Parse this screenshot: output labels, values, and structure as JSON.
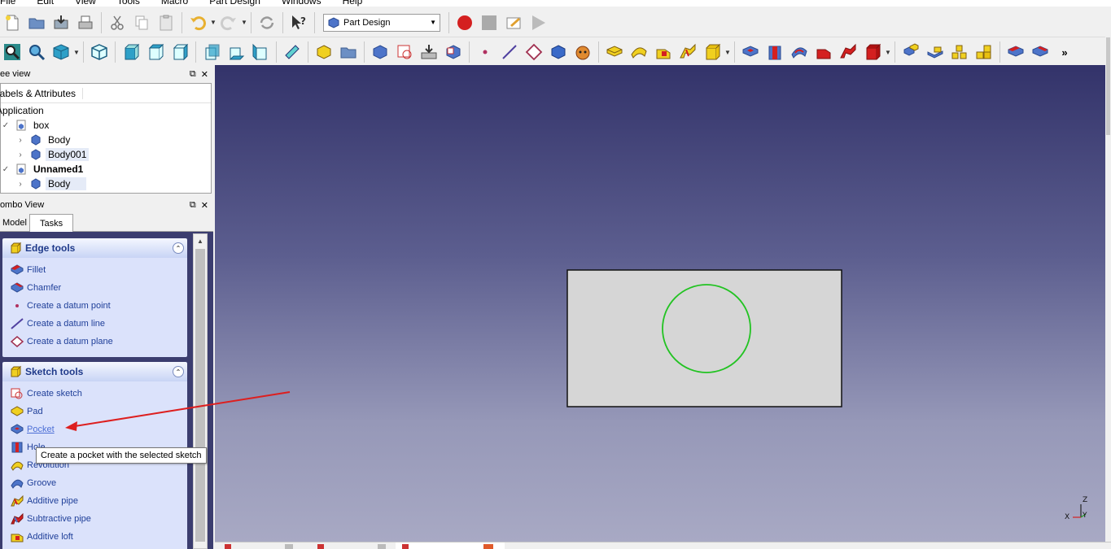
{
  "menu": [
    "File",
    "Edit",
    "View",
    "Tools",
    "Macro",
    "Part Design",
    "Windows",
    "Help"
  ],
  "workbench": {
    "selected": "Part Design"
  },
  "tree_panel": {
    "title": "Tree view",
    "header": "Labels & Attributes",
    "root": "Application",
    "items": [
      {
        "label": "box",
        "level": 1,
        "expanded": true,
        "bold": false
      },
      {
        "label": "Body",
        "level": 2,
        "expanded": false,
        "bold": false
      },
      {
        "label": "Body001",
        "level": 2,
        "expanded": false,
        "bold": false,
        "selected": true
      },
      {
        "label": "Unnamed1",
        "level": 1,
        "expanded": true,
        "bold": true
      },
      {
        "label": "Body",
        "level": 2,
        "expanded": false,
        "bold": false,
        "selected": true
      }
    ]
  },
  "combo": {
    "title": "Combo View",
    "tabs": [
      "Model",
      "Tasks"
    ],
    "active_tab": "Tasks"
  },
  "edge_tools": {
    "title": "Edge tools",
    "items": [
      "Fillet",
      "Chamfer",
      "Create a datum point",
      "Create a datum line",
      "Create a datum plane"
    ]
  },
  "sketch_tools": {
    "title": "Sketch tools",
    "items": [
      "Create sketch",
      "Pad",
      "Pocket",
      "Hole",
      "Revolution",
      "Groove",
      "Additive pipe",
      "Subtractive pipe",
      "Additive loft"
    ]
  },
  "tooltip": "Create a pocket with the selected sketch",
  "colors": {
    "circle": "#22c322",
    "rect_fill": "#d6d6d6",
    "arrow": "#dd1f1f",
    "link": "#1f3f99"
  },
  "axis": {
    "z": "Z",
    "x": "X",
    "y": "Y"
  }
}
